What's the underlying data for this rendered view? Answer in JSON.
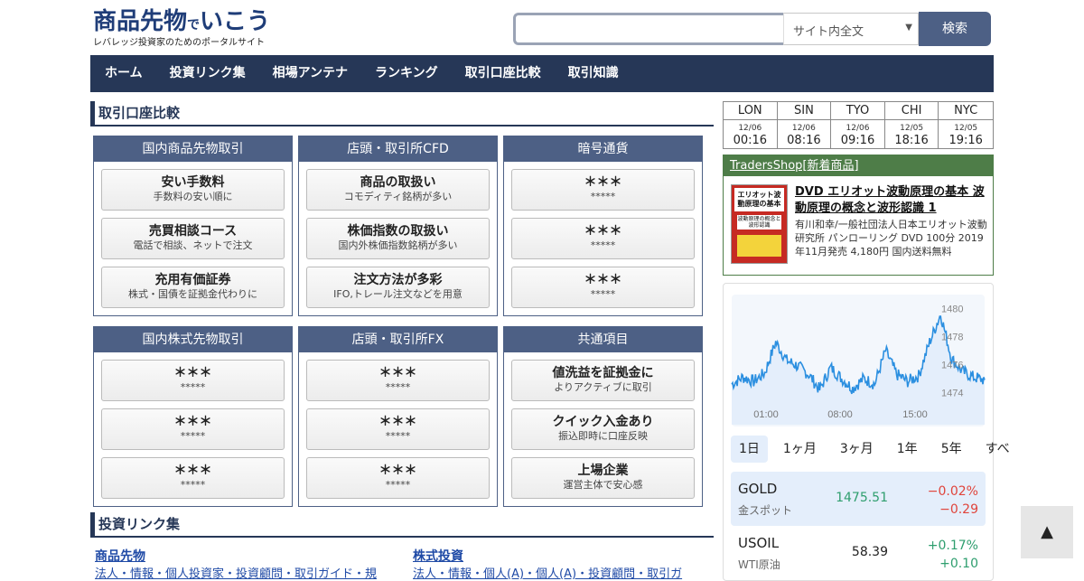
{
  "header": {
    "logo_main_a": "商品先物",
    "logo_main_b": "で",
    "logo_main_c": "いこう",
    "logo_sub": "レバレッジ投資家のためのポータルサイト",
    "search_placeholder": "",
    "search_scope": "サイト内全文",
    "search_button": "検索"
  },
  "nav": [
    "ホーム",
    "投資リンク集",
    "相場アンテナ",
    "ランキング",
    "取引口座比較",
    "取引知識"
  ],
  "comparison": {
    "title": "取引口座比較",
    "panels": [
      {
        "title": "国内商品先物取引",
        "buttons": [
          {
            "t": "安い手数料",
            "s": "手数料の安い順に"
          },
          {
            "t": "売買相談コース",
            "s": "電話で相談、ネットで注文"
          },
          {
            "t": "充用有価証券",
            "s": "株式・国債を証拠金代わりに"
          }
        ]
      },
      {
        "title": "店頭・取引所CFD",
        "buttons": [
          {
            "t": "商品の取扱い",
            "s": "コモディティ銘柄が多い"
          },
          {
            "t": "株価指数の取扱い",
            "s": "国内外株価指数銘柄が多い"
          },
          {
            "t": "注文方法が多彩",
            "s": "IFO,トレール注文などを用意"
          }
        ]
      },
      {
        "title": "暗号通貨",
        "buttons": [
          {
            "t": "＊＊＊",
            "s": "*****"
          },
          {
            "t": "＊＊＊",
            "s": "*****"
          },
          {
            "t": "＊＊＊",
            "s": "*****"
          }
        ]
      },
      {
        "title": "国内株式先物取引",
        "buttons": [
          {
            "t": "＊＊＊",
            "s": "*****"
          },
          {
            "t": "＊＊＊",
            "s": "*****"
          },
          {
            "t": "＊＊＊",
            "s": "*****"
          }
        ]
      },
      {
        "title": "店頭・取引所FX",
        "buttons": [
          {
            "t": "＊＊＊",
            "s": "*****"
          },
          {
            "t": "＊＊＊",
            "s": "*****"
          },
          {
            "t": "＊＊＊",
            "s": "*****"
          }
        ]
      },
      {
        "title": "共通項目",
        "buttons": [
          {
            "t": "値洗益を証拠金に",
            "s": "よりアクティブに取引"
          },
          {
            "t": "クイック入金あり",
            "s": "振込即時に口座反映"
          },
          {
            "t": "上場企業",
            "s": "運営主体で安心感"
          }
        ]
      }
    ]
  },
  "links": {
    "title": "投資リンク集",
    "col1_cat": "商品先物",
    "col1_row": "法人・情報・個人投資家・投資顧問・取引ガイド・規",
    "col2_cat": "株式投資",
    "col2_row": "法人・情報・個人(A)・個人(A)・投資顧問・取引ガ"
  },
  "world_clock": [
    {
      "city": "LON",
      "date": "12/06",
      "time": "00:16"
    },
    {
      "city": "SIN",
      "date": "12/06",
      "time": "08:16"
    },
    {
      "city": "TYO",
      "date": "12/06",
      "time": "09:16"
    },
    {
      "city": "CHI",
      "date": "12/05",
      "time": "18:16"
    },
    {
      "city": "NYC",
      "date": "12/05",
      "time": "19:16"
    }
  ],
  "shop": {
    "head": "TradersShop[新着商品]",
    "book_title": "エリオット波動原理の基本",
    "book_sub": "波動原理の概念と波形認識",
    "title": "DVD エリオット波動原理の基本 波動原理の概念と波形認識 1",
    "desc": "有川和幸/一般社団法人日本エリオット波動研究所 パンローリング DVD 100分 2019年11月発売 4,180円 国内送料無料"
  },
  "chart_data": {
    "type": "area",
    "title": "",
    "xlabel": "",
    "ylabel": "",
    "x_ticks": [
      "01:00",
      "08:00",
      "15:00"
    ],
    "y_ticks": [
      "1480",
      "1478",
      "1476",
      "1474"
    ],
    "ylim": [
      1473.0,
      1481.0
    ],
    "x": [
      "00:00",
      "01:00",
      "02:00",
      "03:00",
      "04:00",
      "05:00",
      "06:00",
      "07:00",
      "08:00",
      "09:00",
      "10:00",
      "11:00",
      "12:00",
      "13:00",
      "14:00",
      "15:00",
      "16:00",
      "17:00",
      "18:00",
      "19:00",
      "20:00",
      "21:00",
      "22:00",
      "23:00"
    ],
    "values": [
      1474.6,
      1475.1,
      1474.8,
      1475.4,
      1477.6,
      1476.3,
      1475.9,
      1475.3,
      1474.2,
      1475.8,
      1475.0,
      1474.3,
      1475.0,
      1474.6,
      1477.0,
      1475.3,
      1474.8,
      1475.2,
      1477.6,
      1479.6,
      1476.4,
      1475.5,
      1475.1,
      1474.9
    ],
    "line_color": "#2b8fe0",
    "fill_color": "#e4eefb"
  },
  "ranges": [
    "1日",
    "1ヶ月",
    "3ヶ月",
    "1年",
    "5年",
    "すべ"
  ],
  "active_range": "1日",
  "quotes": [
    {
      "sym": "GOLD",
      "name": "金スポット",
      "price": "1475.51",
      "chg_pct": "−0.02%",
      "chg": "−0.29",
      "price_color": "#2e9e6e",
      "chg_color": "#e0443b"
    },
    {
      "sym": "USOIL",
      "name": "WTI原油",
      "price": "58.39",
      "chg_pct": "+0.17%",
      "chg": "+0.10",
      "price_color": "#222222",
      "chg_color": "#2e9e6e"
    }
  ],
  "to_top": "▲"
}
